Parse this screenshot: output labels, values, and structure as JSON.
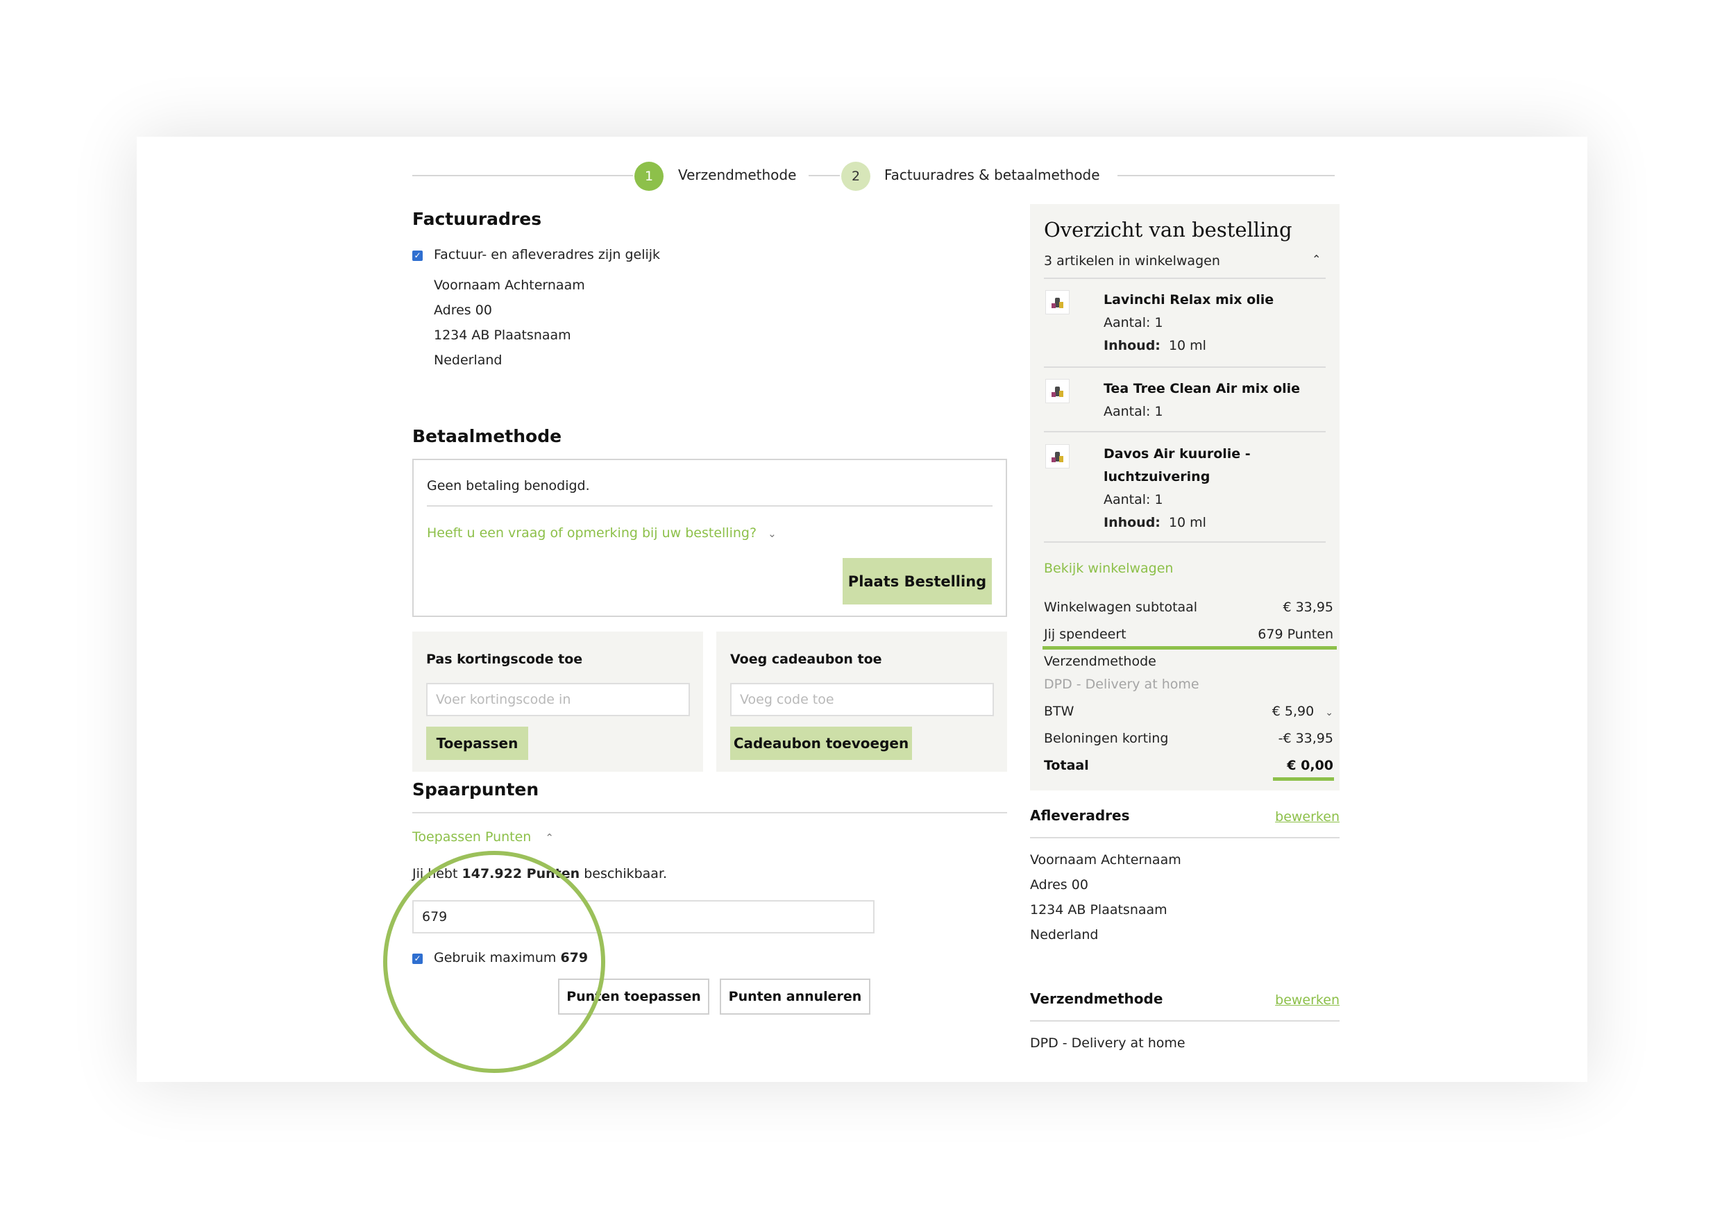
{
  "steps": [
    {
      "number": "1",
      "label": "Verzendmethode"
    },
    {
      "number": "2",
      "label": "Factuuradres & betaalmethode"
    }
  ],
  "billing": {
    "title": "Factuuradres",
    "same_address_label": "Factuur- en afleveradres zijn gelijk",
    "address_lines": [
      "Voornaam Achternaam",
      "Adres 00",
      "1234 AB Plaatsnaam",
      "Nederland"
    ]
  },
  "payment": {
    "title": "Betaalmethode",
    "no_payment_text": "Geen betaling benodigd.",
    "question_link": "Heeft u een vraag of opmerking bij uw bestelling?",
    "place_order_button": "Plaats Bestelling"
  },
  "discount": {
    "title": "Pas kortingscode toe",
    "placeholder": "Voer kortingscode in",
    "button": "Toepassen"
  },
  "giftcard": {
    "title": "Voeg cadeaubon toe",
    "placeholder": "Voeg code toe",
    "button": "Cadeaubon toevoegen"
  },
  "points": {
    "title": "Spaarpunten",
    "toggle_label": "Toepassen Punten",
    "available_prefix": "Jij hebt",
    "available_amount": "147.922 Punten",
    "available_suffix": "beschikbaar.",
    "input_value": "679",
    "use_max_label": "Gebruik maximum",
    "use_max_value": "679",
    "apply_button": "Punten toepassen",
    "cancel_button": "Punten annuleren"
  },
  "summary": {
    "title": "Overzicht van bestelling",
    "cart_count": "3 artikelen in winkelwagen",
    "items": [
      {
        "name_lines": [
          "Lavinchi Relax mix olie"
        ],
        "qty_label": "Aantal: 1",
        "content_label": "Inhoud:",
        "content_value": "10 ml"
      },
      {
        "name_lines": [
          "Tea Tree Clean Air mix olie"
        ],
        "qty_label": "Aantal: 1"
      },
      {
        "name_lines": [
          "Davos Air kuurolie -",
          "luchtzuivering"
        ],
        "qty_label": "Aantal: 1",
        "content_label": "Inhoud:",
        "content_value": "10 ml"
      }
    ],
    "view_cart_link": "Bekijk winkelwagen",
    "subtotal_label": "Winkelwagen subtotaal",
    "subtotal_value": "€ 33,95",
    "spend_label": "Jij spendeert",
    "spend_value": "679 Punten",
    "shipping_label": "Verzendmethode",
    "shipping_value": "DPD - Delivery at home",
    "vat_label": "BTW",
    "vat_value": "€ 5,90",
    "rewards_label": "Beloningen korting",
    "rewards_value": "-€ 33,95",
    "total_label": "Totaal",
    "total_value": "€ 0,00"
  },
  "delivery": {
    "title": "Afleveradres",
    "edit_link": "bewerken",
    "address_lines": [
      "Voornaam Achternaam",
      "Adres 00",
      "1234 AB Plaatsnaam",
      "Nederland"
    ]
  },
  "shipping_method": {
    "title": "Verzendmethode",
    "edit_link": "bewerken",
    "value": "DPD - Delivery at home"
  },
  "colors": {
    "accent_green": "#8dc04a",
    "button_green": "#cddfa8",
    "panel_gray": "#f4f4f1"
  }
}
